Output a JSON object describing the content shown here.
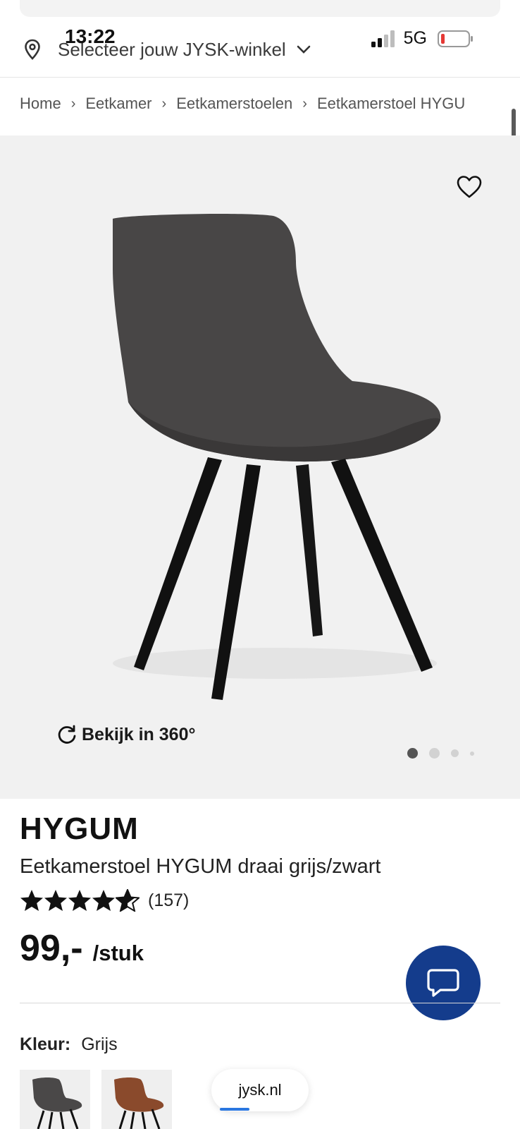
{
  "status_bar": {
    "time": "13:22",
    "network": "5G"
  },
  "store_selector": {
    "label": "Selecteer jouw JYSK-winkel"
  },
  "breadcrumb": [
    "Home",
    "Eetkamer",
    "Eetkamerstoelen",
    "Eetkamerstoel HYGU"
  ],
  "gallery": {
    "view_360_label": "Bekijk in 360°",
    "image_count": 4,
    "active_index": 0
  },
  "product": {
    "brand": "HYGUM",
    "title": "Eetkamerstoel HYGUM draai grijs/zwart",
    "rating": 4.5,
    "review_count": "(157)",
    "price": "99,-",
    "unit": "/stuk"
  },
  "color": {
    "label": "Kleur:",
    "value": "Grijs",
    "options": [
      "grey",
      "brown"
    ]
  },
  "browser": {
    "url": "jysk.nl"
  },
  "icons": {
    "location": "map-pin-icon",
    "chevron": "chevron-down-icon",
    "favorite": "heart-icon",
    "rotate": "rotate-icon",
    "chat": "chat-bubble-icon"
  },
  "colors": {
    "chat_button": "#143c8c",
    "background_gallery": "#f1f1f1"
  }
}
